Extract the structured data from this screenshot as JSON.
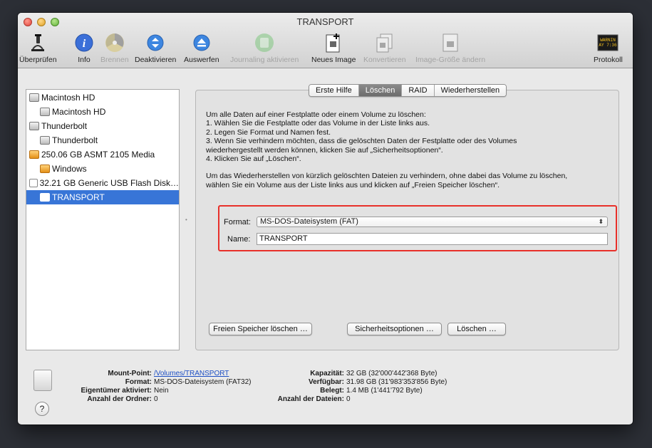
{
  "window": {
    "title": "TRANSPORT"
  },
  "toolbar": {
    "items": [
      {
        "label": "Überprüfen",
        "icon": "microscope-icon",
        "enabled": true
      },
      {
        "label": "Info",
        "icon": "info-icon",
        "enabled": true
      },
      {
        "label": "Brennen",
        "icon": "burn-disc-icon",
        "enabled": false
      },
      {
        "label": "Deaktivieren",
        "icon": "unmount-icon",
        "enabled": true
      },
      {
        "label": "Auswerfen",
        "icon": "eject-icon",
        "enabled": true
      },
      {
        "label": "Journaling aktivieren",
        "icon": "journaling-icon",
        "enabled": false
      },
      {
        "label": "Neues Image",
        "icon": "new-image-icon",
        "enabled": true
      },
      {
        "label": "Konvertieren",
        "icon": "convert-icon",
        "enabled": false
      },
      {
        "label": "Image-Größe ändern",
        "icon": "resize-image-icon",
        "enabled": false
      },
      {
        "label": "Protokoll",
        "icon": "log-icon",
        "enabled": true
      }
    ],
    "log_icon_text": "WARNIN\nAY 7:36"
  },
  "sidebar": {
    "items": [
      {
        "label": "Macintosh HD",
        "level": 0,
        "kind": "disk"
      },
      {
        "label": "Macintosh HD",
        "level": 1,
        "kind": "disk"
      },
      {
        "label": "Thunderbolt",
        "level": 0,
        "kind": "disk"
      },
      {
        "label": "Thunderbolt",
        "level": 1,
        "kind": "disk"
      },
      {
        "label": "250.06 GB ASMT 2105 Media",
        "level": 0,
        "kind": "external"
      },
      {
        "label": "Windows",
        "level": 1,
        "kind": "external"
      },
      {
        "label": "32.21 GB Generic USB Flash Disk…",
        "level": 0,
        "kind": "usb"
      },
      {
        "label": "TRANSPORT",
        "level": 1,
        "kind": "usb",
        "selected": true
      }
    ]
  },
  "tabs": [
    {
      "label": "Erste Hilfe",
      "active": false
    },
    {
      "label": "Löschen",
      "active": true
    },
    {
      "label": "RAID",
      "active": false
    },
    {
      "label": "Wiederherstellen",
      "active": false
    }
  ],
  "instructions": {
    "intro": "Um alle Daten auf einer Festplatte oder einem Volume zu löschen:",
    "step1": "1.    Wählen Sie die Festplatte oder das Volume in der Liste links aus.",
    "step2": "2.    Legen Sie Format und Namen fest.",
    "step3a": "3.    Wenn Sie verhindern möchten, dass die gelöschten Daten der Festplatte oder des Volumes",
    "step3b": "wiederhergestellt werden können, klicken Sie auf „Sicherheitsoptionen“.",
    "step4": "4.    Klicken Sie auf „Löschen“.",
    "free_a": "Um das Wiederherstellen von kürzlich gelöschten Dateien zu verhindern, ohne dabei das Volume zu löschen,",
    "free_b": "wählen Sie ein Volume aus der Liste links aus und klicken auf „Freien Speicher löschen“."
  },
  "form": {
    "format_label": "Format:",
    "format_value": "MS-DOS-Dateisystem (FAT)",
    "name_label": "Name:",
    "name_value": "TRANSPORT",
    "highlight_color": "#e8302a"
  },
  "buttons": {
    "erase_free": "Freien Speicher löschen …",
    "security": "Sicherheitsoptionen …",
    "erase": "Löschen …"
  },
  "info": {
    "mount_label": "Mount-Point:",
    "mount_value": "/Volumes/TRANSPORT",
    "format_label": "Format:",
    "format_value": "MS-DOS-Dateisystem (FAT32)",
    "owners_label": "Eigentümer aktiviert:",
    "owners_value": "Nein",
    "folders_label": "Anzahl der Ordner:",
    "folders_value": "0",
    "capacity_label": "Kapazität:",
    "capacity_value": "32 GB (32'000'442'368 Byte)",
    "available_label": "Verfügbar:",
    "available_value": "31.98 GB (31'983'353'856 Byte)",
    "used_label": "Belegt:",
    "used_value": "1.4 MB (1'441'792 Byte)",
    "files_label": "Anzahl der Dateien:",
    "files_value": "0",
    "help": "?"
  }
}
